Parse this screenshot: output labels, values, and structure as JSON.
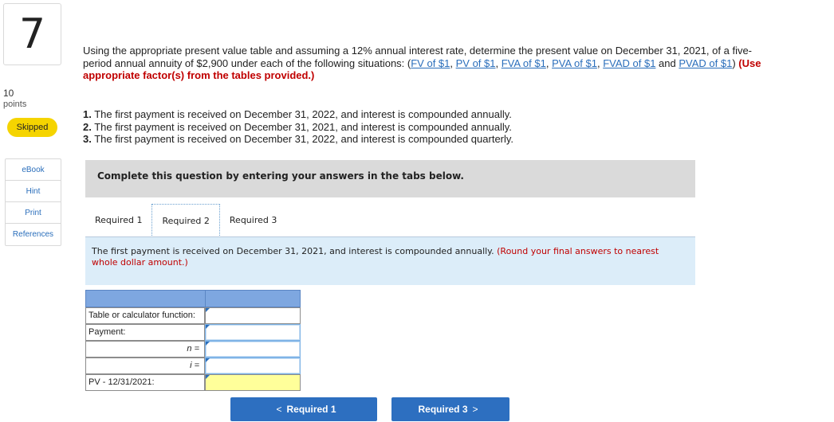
{
  "question": {
    "number": "7",
    "points_value": "10",
    "points_label": "points",
    "status": "Skipped"
  },
  "side_links": [
    "eBook",
    "Hint",
    "Print",
    "References"
  ],
  "prompt": {
    "text": "Using the appropriate present value table and assuming a 12% annual interest rate, determine the present value on December 31, 2021, of a five-period annual annuity of $2,900 under each of the following situations: (",
    "links": [
      "FV of $1",
      "PV of $1",
      "FVA of $1",
      "PVA of $1",
      "FVAD of $1",
      "PVAD of $1"
    ],
    "sep_comma": ", ",
    "sep_and": " and ",
    "close_paren": ") ",
    "instruction": "(Use appropriate factor(s) from the tables provided.)"
  },
  "situations": [
    {
      "num": "1.",
      "text": " The first payment is received on December 31, 2022, and interest is compounded annually."
    },
    {
      "num": "2.",
      "text": " The first payment is received on December 31, 2021, and interest is compounded annually."
    },
    {
      "num": "3.",
      "text": " The first payment is received on December 31, 2022, and interest is compounded quarterly."
    }
  ],
  "complete_banner": "Complete this question by entering your answers in the tabs below.",
  "tabs": [
    {
      "label": "Required 1",
      "active": false
    },
    {
      "label": "Required 2",
      "active": true
    },
    {
      "label": "Required 3",
      "active": false
    }
  ],
  "instruction": {
    "text": "The first payment is received on December 31, 2021, and interest is compounded annually. ",
    "note": "(Round your final answers to nearest whole dollar amount.)"
  },
  "table": {
    "rows": [
      {
        "label": "Table or calculator function:",
        "value": ""
      },
      {
        "label": "Payment:",
        "value": ""
      },
      {
        "label": "n =",
        "value": ""
      },
      {
        "label": "i =",
        "value": ""
      },
      {
        "label": "PV - 12/31/2021:",
        "value": ""
      }
    ]
  },
  "nav": {
    "prev_label": "Required 1",
    "next_label": "Required 3",
    "prev_chevron": "<",
    "next_chevron": ">"
  },
  "colors": {
    "status_bg": "#f5d400",
    "link": "#2a6ebb",
    "accent_red": "#c00000",
    "nav_button": "#2d6fc0",
    "answer_highlight": "#ffff9a"
  }
}
